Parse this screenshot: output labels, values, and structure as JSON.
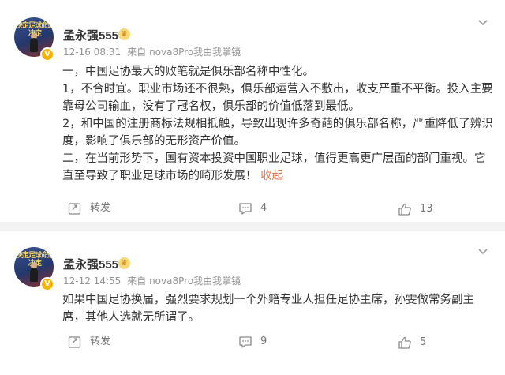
{
  "posts": [
    {
      "username": "孟永强555",
      "avatar_text": "决定足球命运决定",
      "timestamp": "12-16 08:31",
      "source": "来自 nova8Pro我由我掌镜",
      "paragraphs": [
        "一，中国足协最大的败笔就是俱乐部名称中性化。",
        "1，不合时宜。职业市场还不很熟，俱乐部运营入不敷出，收支严重不平衡。投入主要靠母公司输血，没有了冠名权，俱乐部的价值低落到最低。",
        "2，和中国的注册商标法规相抵触，导致出现许多奇葩的俱乐部名称，严重降低了辨识度，影响了俱乐部的无形资产价值。",
        "二，在当前形势下，国有资本投资中国职业足球，值得更高更广层面的部门重视。它直至导致了职业足球市场的畸形发展！"
      ],
      "collapse_label": "收起",
      "repost_label": "转发",
      "comments": "4",
      "likes": "13"
    },
    {
      "username": "孟永强555",
      "avatar_text": "决定足球命运决定",
      "timestamp": "12-12 14:55",
      "source": "来自 nova8Pro我由我掌镜",
      "paragraphs": [
        "如果中国足协换届，强烈要求规划一个外籍专业人担任足协主席，孙雯做常务副主席，其他人选就无所谓了。"
      ],
      "repost_label": "转发",
      "comments": "9",
      "likes": "5"
    }
  ],
  "colors": {
    "link": "#eb7350",
    "meta": "#939393",
    "separator": "#f2f2f2",
    "verified": "#f6b400"
  }
}
